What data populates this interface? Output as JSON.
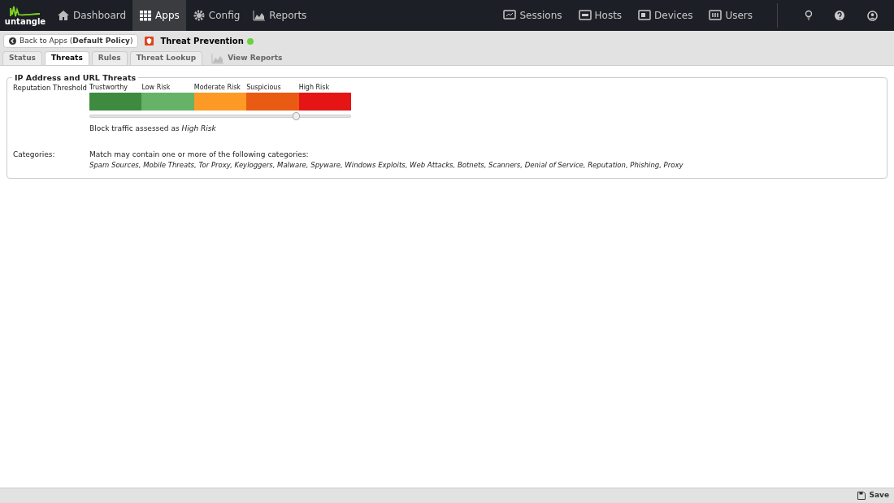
{
  "logo": {
    "text": "untangle"
  },
  "nav": [
    {
      "label": "Dashboard",
      "selected": false
    },
    {
      "label": "Apps",
      "selected": true
    },
    {
      "label": "Config",
      "selected": false
    },
    {
      "label": "Reports",
      "selected": false
    }
  ],
  "nav_right": [
    {
      "label": "Sessions"
    },
    {
      "label": "Hosts"
    },
    {
      "label": "Devices"
    },
    {
      "label": "Users"
    }
  ],
  "back_button": {
    "text": "Back to Apps (**Default Policy**)"
  },
  "app": {
    "title": "Threat Prevention",
    "running": true
  },
  "tabs": [
    {
      "label": "Status",
      "selected": false,
      "kind": "tab"
    },
    {
      "label": "Threats",
      "selected": true,
      "kind": "tab"
    },
    {
      "label": "Rules",
      "selected": false,
      "kind": "tab"
    },
    {
      "label": "Threat Lookup",
      "selected": false,
      "kind": "tab"
    },
    {
      "label": "View Reports",
      "selected": false,
      "kind": "link"
    }
  ],
  "panel": {
    "title": "IP Address and URL Threats",
    "threshold_label": "Reputation Threshold",
    "levels": [
      {
        "label": "Trustworthy",
        "color": "#3e8a3e"
      },
      {
        "label": "Low Risk",
        "color": "#66b266"
      },
      {
        "label": "Moderate Risk",
        "color": "#fd9a26"
      },
      {
        "label": "Suspicious",
        "color": "#e95a12"
      },
      {
        "label": "High Risk",
        "color": "#e51515"
      }
    ],
    "slider": {
      "level": 0.79
    },
    "block_text": "Block traffic assessed as *High Risk*",
    "categories_label": "Categories:",
    "categories_intro": "Match may contain one or more of the following categories:",
    "categories": "Spam Sources, Mobile Threats, Tor Proxy, Keyloggers, Malware, Spyware, Windows Exploits, Web Attacks, Botnets, Scanners, Denial of Service, Reputation, Phishing, Proxy"
  },
  "footer": {
    "save": "Save"
  }
}
